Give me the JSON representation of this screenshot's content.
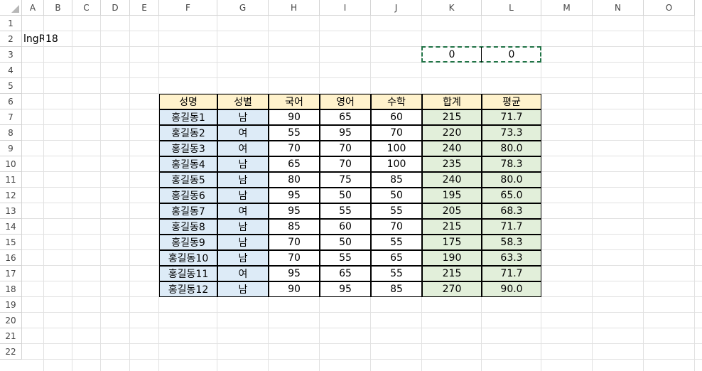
{
  "columns": [
    "A",
    "B",
    "C",
    "D",
    "E",
    "F",
    "G",
    "H",
    "I",
    "J",
    "K",
    "L",
    "M",
    "N",
    "O"
  ],
  "rows": [
    "1",
    "2",
    "3",
    "4",
    "5",
    "6",
    "7",
    "8",
    "9",
    "10",
    "11",
    "12",
    "13",
    "14",
    "15",
    "16",
    "17",
    "18",
    "19",
    "20",
    "21",
    "22"
  ],
  "cells": {
    "a2": "lngR",
    "b2": "18",
    "k3": "0",
    "l3": "0"
  },
  "table": {
    "headers": [
      "성명",
      "성별",
      "국어",
      "영어",
      "수학",
      "합계",
      "평균"
    ],
    "rows": [
      [
        "홍길동1",
        "남",
        "90",
        "65",
        "60",
        "215",
        "71.7"
      ],
      [
        "홍길동2",
        "여",
        "55",
        "95",
        "70",
        "220",
        "73.3"
      ],
      [
        "홍길동3",
        "여",
        "70",
        "70",
        "100",
        "240",
        "80.0"
      ],
      [
        "홍길동4",
        "남",
        "65",
        "70",
        "100",
        "235",
        "78.3"
      ],
      [
        "홍길동5",
        "남",
        "80",
        "75",
        "85",
        "240",
        "80.0"
      ],
      [
        "홍길동6",
        "남",
        "95",
        "50",
        "50",
        "195",
        "65.0"
      ],
      [
        "홍길동7",
        "여",
        "95",
        "55",
        "55",
        "205",
        "68.3"
      ],
      [
        "홍길동8",
        "남",
        "85",
        "60",
        "70",
        "215",
        "71.7"
      ],
      [
        "홍길동9",
        "남",
        "70",
        "50",
        "55",
        "175",
        "58.3"
      ],
      [
        "홍길동10",
        "남",
        "70",
        "55",
        "65",
        "190",
        "63.3"
      ],
      [
        "홍길동11",
        "여",
        "95",
        "65",
        "55",
        "215",
        "71.7"
      ],
      [
        "홍길동12",
        "남",
        "90",
        "95",
        "85",
        "270",
        "90.0"
      ]
    ]
  },
  "colors": {
    "header_fill": "#fff2cc",
    "name_gender_fill": "#ddebf7",
    "calc_fill": "#e2efda",
    "selection_border": "#217346"
  }
}
